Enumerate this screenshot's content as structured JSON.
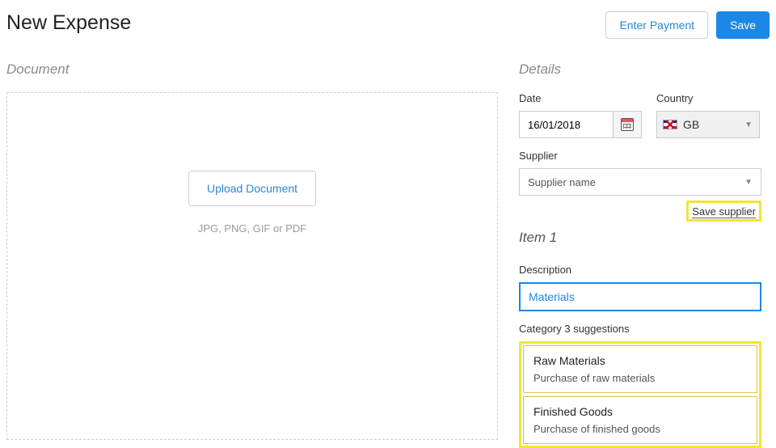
{
  "header": {
    "title": "New Expense",
    "enter_payment_label": "Enter Payment",
    "save_label": "Save"
  },
  "document_section": {
    "heading": "Document",
    "upload_label": "Upload Document",
    "hint": "JPG, PNG, GIF or PDF"
  },
  "details_section": {
    "heading": "Details",
    "date_label": "Date",
    "date_value": "16/01/2018",
    "country_label": "Country",
    "country_value": "GB",
    "supplier_label": "Supplier",
    "supplier_placeholder": "Supplier name",
    "save_supplier_label": "Save supplier"
  },
  "item_section": {
    "heading": "Item 1",
    "description_label": "Description",
    "description_value": "Materials",
    "category_label": "Category 3 suggestions",
    "suggestions": [
      {
        "title": "Raw Materials",
        "desc": "Purchase of raw materials"
      },
      {
        "title": "Finished Goods",
        "desc": "Purchase of finished goods"
      }
    ]
  }
}
